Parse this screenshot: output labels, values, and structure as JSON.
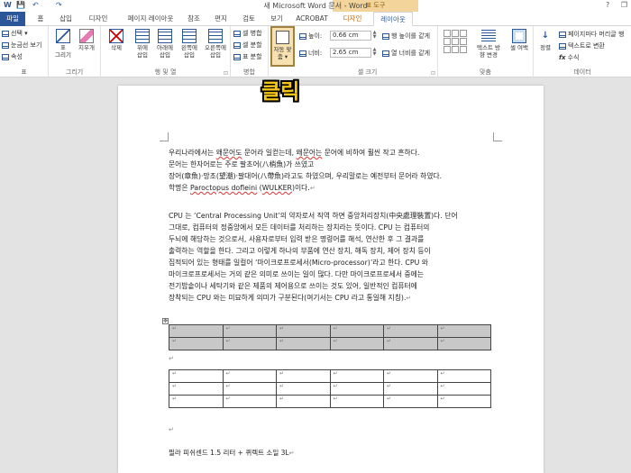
{
  "window": {
    "title": "새 Microsoft Word 문서 - Word",
    "context_group": "표 도구",
    "help": "?",
    "minimize": "—",
    "restore": "❐"
  },
  "quick_access": {
    "word_icon": "W",
    "save": "💾",
    "undo": "↶",
    "redo": "↷"
  },
  "tabs": [
    {
      "label": "파일"
    },
    {
      "label": "홈"
    },
    {
      "label": "삽입"
    },
    {
      "label": "디자인"
    },
    {
      "label": "페이지 레이아웃"
    },
    {
      "label": "참조"
    },
    {
      "label": "편지"
    },
    {
      "label": "검토"
    },
    {
      "label": "보기"
    },
    {
      "label": "ACROBAT"
    },
    {
      "label": "디자인"
    },
    {
      "label": "레이아웃"
    }
  ],
  "ribbon": {
    "table_group": {
      "select": "선택 ▾",
      "gridlines": "눈금선 보기",
      "properties": "속성",
      "label": "표"
    },
    "draw_group": {
      "draw": "표\n그리기",
      "eraser": "지우개",
      "label": "그리기"
    },
    "rows_cols_group": {
      "delete": "삭제",
      "insert_above": "위에\n삽입",
      "insert_below": "아래에\n삽입",
      "insert_left": "왼쪽에\n삽입",
      "insert_right": "오른쪽에\n삽입",
      "label": "행 및 열",
      "launcher": "⊡"
    },
    "merge_group": {
      "merge": "셀 병합",
      "split": "셀 분할",
      "split_table": "표 분할",
      "label": "병합"
    },
    "autofit": {
      "label": "자동 맞\n춤 ▾"
    },
    "cell_size_group": {
      "height_label": "높이:",
      "height_value": "0.66 cm",
      "width_label": "너비:",
      "width_value": "2.65 cm",
      "distribute_rows": "행 높이를 같게",
      "distribute_cols": "열 너비를 같게",
      "label": "셀 크기",
      "launcher": "⊡"
    },
    "alignment_group": {
      "text_direction": "텍스트 방\n향 변경",
      "cell_margins": "셀 여백",
      "label": "맞춤"
    },
    "data_group": {
      "sort": "정렬",
      "repeat_header": "페이지마다 머리글 행",
      "convert": "텍스트로 변환",
      "formula": "수식",
      "label": "데이터"
    }
  },
  "callout": "클릭",
  "document": {
    "para1": [
      {
        "pre": "우리나라에서는 ",
        "err": "왜문어도",
        "mid": " 문어라 일컫는데, ",
        "err2": "왜문어는",
        "post": " 문어에 비하여 훨씬 작고 흔하다."
      },
      {
        "text": "문어는 한자어로는 주로 팔초어(八梢魚)가 쓰였고"
      },
      {
        "text": "장어(章魚)·망조(望潮)·팔대어(八帶魚)라고도 하였으며, 우리말로는 예전부터 문어라 하였다."
      },
      {
        "pre": "학명은 ",
        "err": "Paroctopus dofleini",
        "post": " (",
        "err2": "WULKER",
        "tail": ")이다."
      }
    ],
    "para2": [
      "CPU 는 ‘Central Processing Unit’의 약자로서 직역 하면 중앙처리장치(中央處理裝置)다. 단어",
      "그대로, 컴퓨터의 정중앙에서 모든 데이터를 처리하는 장치라는 뜻이다. CPU 는 컴퓨터의",
      "두뇌에 해당하는 것으로서, 사용자로부터 입력 받은 명령어를 해석, 연산한 후 그 결과를",
      "출력하는 역할을 한다. 그리고 이렇게 하나의 부품에 연산 장치, 해독 장치, 제어 장치 등이",
      "집적되어 있는 형태를 일컬어 ‘마이크로프로세서(Micro-processor)’라고 한다. CPU 와",
      "마이크로프로세서는 거의 같은 의미로 쓰이는 일이 많다. 다만 마이크로프로세서 중에는",
      "전기밥솥이나 세탁기와 같은 제품의 제어용으로 쓰이는 것도 있어, 일반적인 컴퓨터에",
      "장착되는 CPU 와는 미묘하게 의미가 구분된다(여기서는 CPU 라고 통일해 지칭)."
    ],
    "cell_mark": "↵",
    "para_mark": "↵",
    "table_handle": "✥",
    "footer_text": "필라 피쉬센드 1.5 리터 + 퀴렉트 소일 3L"
  }
}
